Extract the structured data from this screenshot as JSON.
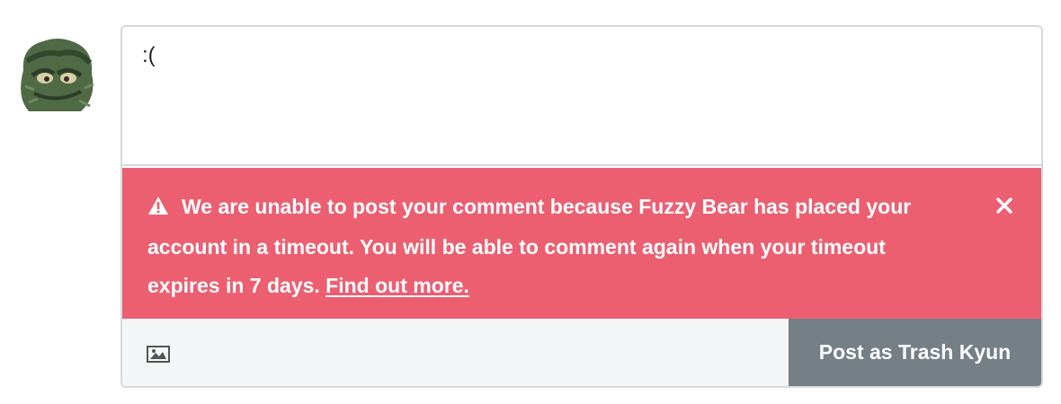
{
  "avatar": {
    "icon": "oscar-the-grouch-avatar"
  },
  "comment_box": {
    "value": ":("
  },
  "alert": {
    "icon": "warning-triangle-icon",
    "message": "We are unable to post your comment because Fuzzy Bear has placed your account in a timeout. You will be able to comment again when your timeout expires in 7 days.",
    "link_label": "Find out more.",
    "close_icon": "close-icon",
    "background": "#ec5f71"
  },
  "footer": {
    "image_icon": "image-icon",
    "post_button_label": "Post as Trash Kyun",
    "post_button_color": "#757f86"
  }
}
